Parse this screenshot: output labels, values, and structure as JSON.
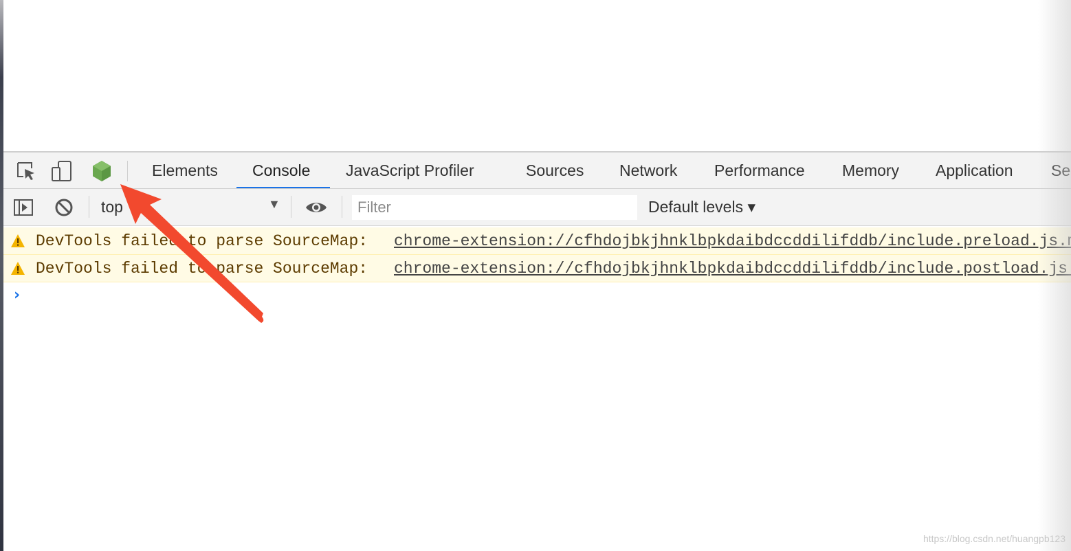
{
  "devtools": {
    "toolbar_icons": [
      {
        "icon": "inspect-element-icon"
      },
      {
        "icon": "device-toolbar-icon"
      },
      {
        "icon": "nodejs-hexagon-icon",
        "color": "#6aa84f"
      }
    ],
    "tabs": [
      {
        "label": "Elements",
        "active": false
      },
      {
        "label": "Console",
        "active": true
      },
      {
        "label": "JavaScript Profiler",
        "active": false
      },
      {
        "label": "Sources",
        "active": false
      },
      {
        "label": "Network",
        "active": false
      },
      {
        "label": "Performance",
        "active": false
      },
      {
        "label": "Memory",
        "active": false
      },
      {
        "label": "Application",
        "active": false
      },
      {
        "label": "Se",
        "active": false
      }
    ],
    "active_tab_color": "#1a73e8"
  },
  "console_toolbar": {
    "sidebar_icon": "show-sidebar-icon",
    "clear_icon": "clear-console-icon",
    "context": "top",
    "eye_icon": "live-expression-eye-icon",
    "filter_placeholder": "Filter",
    "levels_label": "Default levels ▾"
  },
  "messages": [
    {
      "level": "warning",
      "icon": "warning-triangle-icon",
      "text": "DevTools failed to parse SourceMap:",
      "link": "chrome-extension://cfhdojbkjhnklbpkdaibdccddilifddb/include.preload.js.map"
    },
    {
      "level": "warning",
      "icon": "warning-triangle-icon",
      "text": "DevTools failed to parse SourceMap:",
      "link": "chrome-extension://cfhdojbkjhnklbpkdaibdccddilifddb/include.postload.js.map"
    }
  ],
  "prompt_symbol": "›",
  "annotation": {
    "icon": "red-arrow-annotation",
    "color": "#f2492e"
  },
  "colors": {
    "warning_bg": "#fffbe5",
    "warning_text": "#5c3b00",
    "warning_icon": "#f4b400",
    "toolbar_bg": "#f3f3f3"
  },
  "watermark": "https://blog.csdn.net/huangpb123"
}
